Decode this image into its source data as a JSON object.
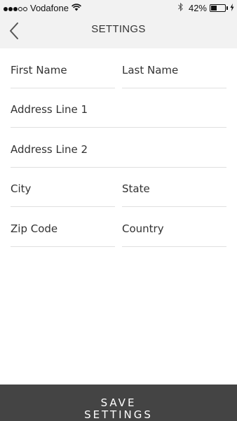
{
  "status_bar": {
    "signal_filled": 3,
    "signal_total": 5,
    "carrier": "Vodafone",
    "bluetooth_icon": "bluetooth-icon",
    "battery_percent_text": "42%",
    "battery_level": 0.42
  },
  "header": {
    "back_icon": "chevron-left-icon",
    "title": "SETTINGS"
  },
  "form": {
    "first_name": {
      "placeholder": "First Name",
      "value": ""
    },
    "last_name": {
      "placeholder": "Last Name",
      "value": ""
    },
    "address_line_1": {
      "placeholder": "Address Line 1",
      "value": ""
    },
    "address_line_2": {
      "placeholder": "Address Line 2",
      "value": ""
    },
    "city": {
      "placeholder": "City",
      "value": ""
    },
    "state": {
      "placeholder": "State",
      "value": ""
    },
    "zip_code": {
      "placeholder": "Zip Code",
      "value": ""
    },
    "country": {
      "placeholder": "Country",
      "value": ""
    }
  },
  "save_button": {
    "line1": "SAVE",
    "line2": "SETTINGS"
  },
  "colors": {
    "header_bg": "#f2f2f2",
    "save_bg": "#444444",
    "divider": "#e0e0e0"
  }
}
